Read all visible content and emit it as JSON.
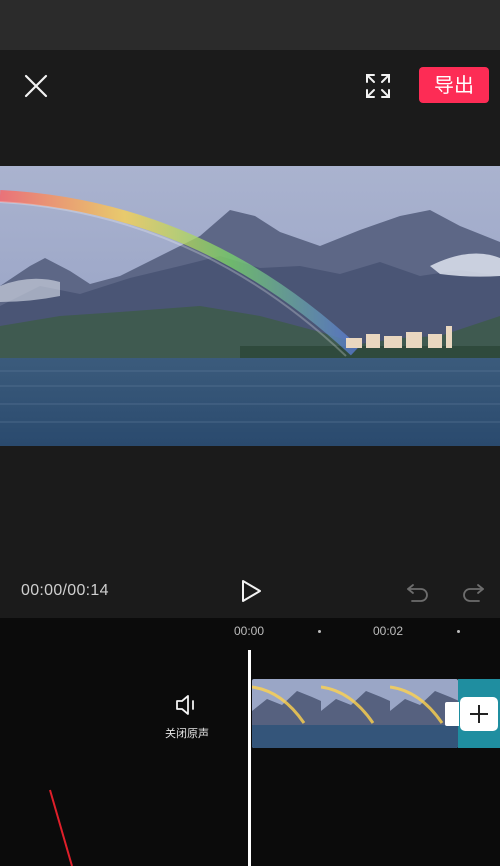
{
  "top_bar": {
    "close_icon": "close-icon",
    "fullscreen_icon": "fullscreen-icon",
    "export_label": "导出",
    "accent_color": "#fd2c55"
  },
  "player": {
    "time_readout": "00:00/00:14",
    "play_icon": "play-icon",
    "undo_icon": "undo-icon",
    "redo_icon": "redo-icon"
  },
  "timeline": {
    "ruler": [
      "00:00",
      "00:02"
    ],
    "mute_label": "关闭原声",
    "mute_icon": "speaker-icon",
    "add_clip_icon": "plus-icon"
  }
}
